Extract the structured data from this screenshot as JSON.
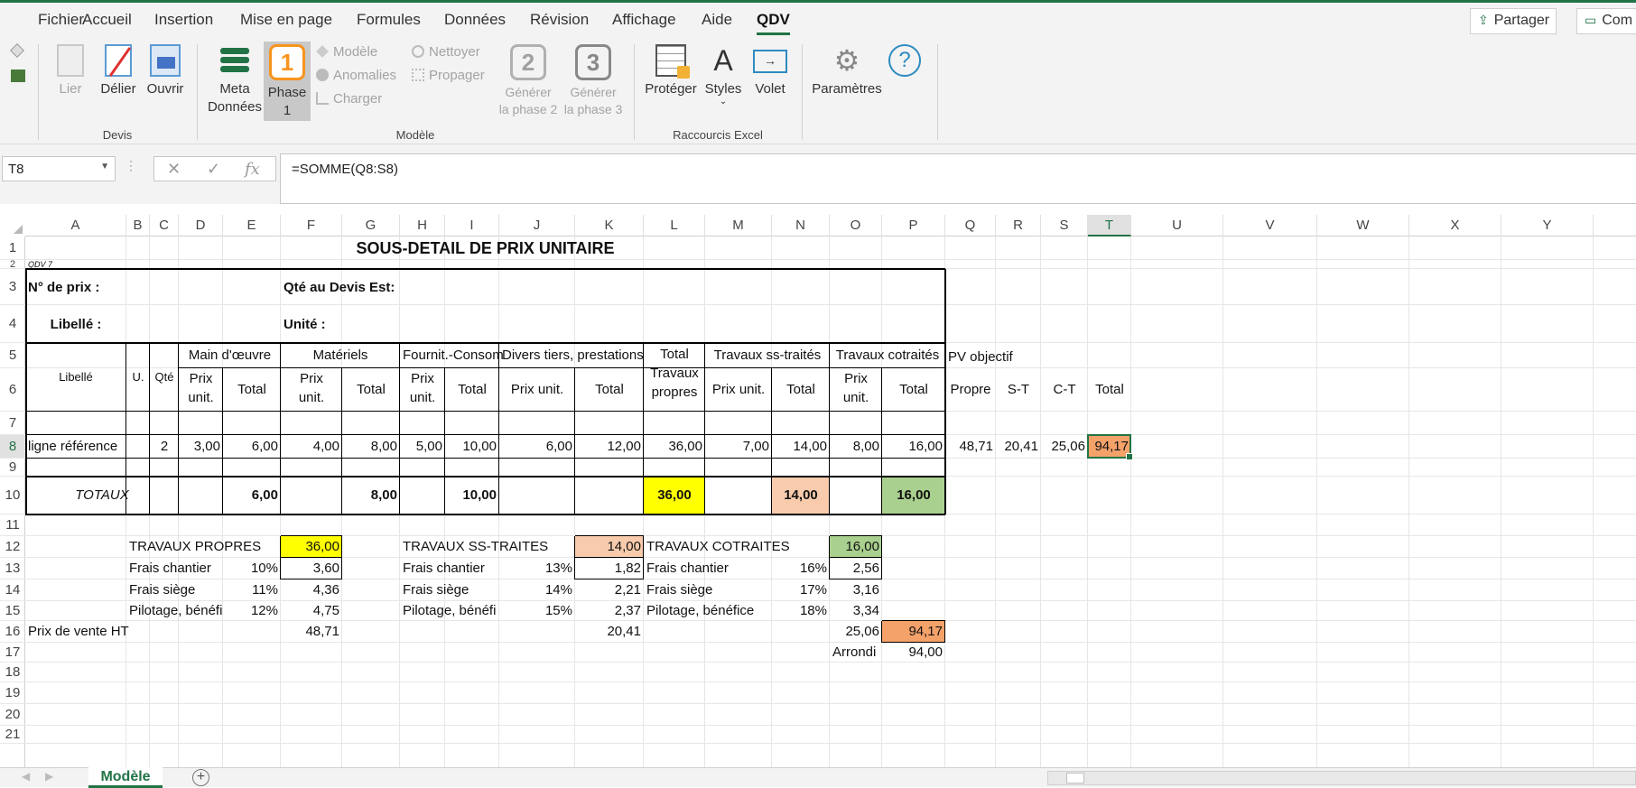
{
  "menu": {
    "tabs": [
      "Fichier",
      "Accueil",
      "Insertion",
      "Mise en page",
      "Formules",
      "Données",
      "Révision",
      "Affichage",
      "Aide",
      "QDV"
    ],
    "share_label": "Partager",
    "comments_label": "Com"
  },
  "ribbon": {
    "devis": {
      "group_label": "Devis",
      "lier": "Lier",
      "delier": "Délier",
      "ouvrir": "Ouvrir"
    },
    "modele": {
      "group_label": "Modèle",
      "meta_line1": "Meta",
      "meta_line2": "Données",
      "phase_line1": "Phase",
      "phase_line2": "1",
      "phase_num": "1",
      "modele": "Modèle",
      "anomalies": "Anomalies",
      "charger": "Charger",
      "nettoyer": "Nettoyer",
      "propager": "Propager",
      "gen2_line1": "Générer",
      "gen2_line2": "la phase 2",
      "gen2_num": "2",
      "gen3_line1": "Générer",
      "gen3_line2": "la phase 3",
      "gen3_num": "3"
    },
    "raccourcis": {
      "group_label": "Raccourcis Excel",
      "proteger": "Protéger",
      "styles": "Styles",
      "volet": "Volet"
    },
    "parametres": "Paramètres"
  },
  "formula_bar": {
    "name_box": "T8",
    "formula": "=SOMME(Q8:S8)"
  },
  "columns": [
    "A",
    "B",
    "C",
    "D",
    "E",
    "F",
    "G",
    "H",
    "I",
    "J",
    "K",
    "L",
    "M",
    "N",
    "O",
    "P",
    "Q",
    "R",
    "S",
    "T",
    "U",
    "V",
    "W",
    "X",
    "Y"
  ],
  "rows": [
    "1",
    "2",
    "3",
    "4",
    "5",
    "6",
    "7",
    "8",
    "9",
    "10",
    "11",
    "12",
    "13",
    "14",
    "15",
    "16",
    "17",
    "18",
    "19",
    "20",
    "21"
  ],
  "sheet": {
    "title": "SOUS-DETAIL DE PRIX UNITAIRE",
    "qdv": "QDV 7",
    "no_prix": "N° de prix :",
    "qte_devis": "Qté au Devis Est:",
    "libelle_label": "Libellé :",
    "unite": "Unité :",
    "h_libelle": "Libellé",
    "h_u": "U.",
    "h_qte": "Qté",
    "h_main": "Main d'œuvre",
    "h_materiels": "Matériels",
    "h_fournit": "Fournit.-Consom",
    "h_divers": "Divers tiers, prestations",
    "h_total_travaux_1": "Total",
    "h_total_travaux_2": "Travaux",
    "h_total_travaux_3": "propres",
    "h_ss_traites": "Travaux ss-traités",
    "h_cotraites": "Travaux cotraités",
    "h_pv": "PV objectif",
    "h_prix": "Prix",
    "h_unit": "unit.",
    "h_prix_unit": "Prix unit.",
    "h_total": "Total",
    "h_propre": "Propre",
    "h_st": "S-T",
    "h_ct": "C-T",
    "r8": {
      "lib": "ligne référence",
      "qte": "2",
      "d": "3,00",
      "e": "6,00",
      "f": "4,00",
      "g": "8,00",
      "h": "5,00",
      "i": "10,00",
      "j": "6,00",
      "k": "12,00",
      "l": "36,00",
      "m": "7,00",
      "n": "14,00",
      "o": "8,00",
      "p": "16,00",
      "q": "48,71",
      "r": "20,41",
      "s": "25,06",
      "t": "94,17"
    },
    "totaux": {
      "label": "TOTAUX",
      "e": "6,00",
      "g": "8,00",
      "i": "10,00",
      "l": "36,00",
      "n": "14,00",
      "p": "16,00"
    },
    "recap": {
      "tp": "TRAVAUX PROPRES",
      "tp_val": "36,00",
      "fc": "Frais chantier",
      "fc_pct": "10%",
      "fc_val": "3,60",
      "fs": "Frais siège",
      "fs_pct": "11%",
      "fs_val": "4,36",
      "pb": "Pilotage, bénéfi",
      "pb_pct": "12%",
      "pb_val": "4,75",
      "pv": "Prix de vente HT",
      "pv_val": "48,71",
      "st": "TRAVAUX SS-TRAITES",
      "st_val": "14,00",
      "st_fc": "Frais chantier",
      "st_fc_pct": "13%",
      "st_fc_val": "1,82",
      "st_fs": "Frais siège",
      "st_fs_pct": "14%",
      "st_fs_val": "2,21",
      "st_pb": "Pilotage, bénéfi",
      "st_pb_pct": "15%",
      "st_pb_val": "2,37",
      "st_pv_val": "20,41",
      "ct": "TRAVAUX COTRAITES",
      "ct_val": "16,00",
      "ct_fc": "Frais chantier",
      "ct_fc_pct": "16%",
      "ct_fc_val": "2,56",
      "ct_fs": "Frais siège",
      "ct_fs_pct": "17%",
      "ct_fs_val": "3,16",
      "ct_pb": "Pilotage, bénéfice",
      "ct_pb_pct": "18%",
      "ct_pb_val": "3,34",
      "ct_pv_val": "25,06",
      "total_val": "94,17",
      "arrondi": "Arrondi",
      "arrondi_val": "94,00"
    }
  },
  "sheet_tab": "Modèle",
  "colors": {
    "accent": "#217346",
    "yellow": "#ffff00",
    "salmon": "#f8cbad",
    "green": "#a9d08e",
    "orange": "#f4a26a"
  }
}
